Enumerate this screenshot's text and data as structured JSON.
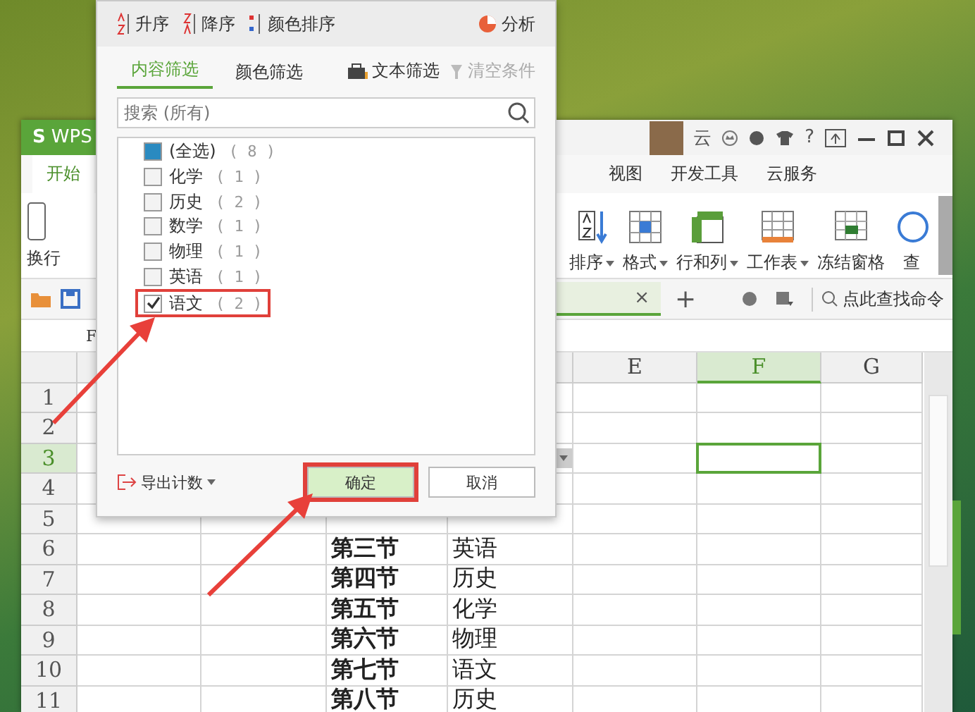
{
  "app": {
    "logo_mark": "S",
    "logo": "WPS",
    "user": "云",
    "help": "?",
    "menu_tabs": [
      {
        "label": "开始",
        "selected": true
      },
      {
        "label": "视图",
        "selected": false
      },
      {
        "label": "开发工具",
        "selected": false
      },
      {
        "label": "云服务",
        "selected": false
      }
    ],
    "left_tool": "换行",
    "tools": [
      {
        "kind": "sort",
        "label": "排序",
        "dropdown": true
      },
      {
        "kind": "format",
        "label": "格式",
        "dropdown": true
      },
      {
        "kind": "rowcol",
        "label": "行和列",
        "dropdown": true
      },
      {
        "kind": "sheet",
        "label": "工作表",
        "dropdown": true
      },
      {
        "kind": "freeze",
        "label": "冻结窗格",
        "dropdown": false
      },
      {
        "kind": "find",
        "label": "查",
        "dropdown": false
      }
    ],
    "doc_close": "×",
    "doc_add": "+",
    "command_search": "点此查找命令",
    "formula_ref": "F",
    "columns": [
      {
        "label": "E",
        "selected": false
      },
      {
        "label": "F",
        "selected": true
      },
      {
        "label": "G",
        "selected": false
      }
    ],
    "rows": [
      {
        "header": "1",
        "selected": false
      },
      {
        "header": "2",
        "selected": false
      },
      {
        "header": "3",
        "selected": true,
        "filter": true
      },
      {
        "header": "4",
        "selected": false
      },
      {
        "header": "5",
        "selected": false
      },
      {
        "header": "6",
        "selected": false,
        "lesson": "第三节",
        "subject": "英语"
      },
      {
        "header": "7",
        "selected": false,
        "lesson": "第四节",
        "subject": "历史"
      },
      {
        "header": "8",
        "selected": false,
        "lesson": "第五节",
        "subject": "化学"
      },
      {
        "header": "9",
        "selected": false,
        "lesson": "第六节",
        "subject": "物理"
      },
      {
        "header": "10",
        "selected": false,
        "lesson": "第七节",
        "subject": "语文"
      },
      {
        "header": "11",
        "selected": false,
        "lesson": "第八节",
        "subject": "历史"
      }
    ]
  },
  "dialog": {
    "sort_bar": [
      {
        "kind": "asc",
        "label": "升序"
      },
      {
        "kind": "desc",
        "label": "降序"
      },
      {
        "kind": "color",
        "label": "颜色排序"
      }
    ],
    "analyze": "分析",
    "tabs": [
      {
        "label": "内容筛选",
        "selected": true
      },
      {
        "label": "颜色筛选",
        "selected": false
      }
    ],
    "text_filter": "文本筛选",
    "clear": {
      "label": "清空条件",
      "disabled": true
    },
    "search": {
      "placeholder": "搜索 (所有)"
    },
    "items": [
      {
        "label": "(全选)",
        "count": "( 8 )",
        "checked": false,
        "partial": true,
        "highlighted": false
      },
      {
        "label": "化学",
        "count": "( 1 )",
        "checked": false,
        "partial": false,
        "highlighted": false
      },
      {
        "label": "历史",
        "count": "( 2 )",
        "checked": false,
        "partial": false,
        "highlighted": false
      },
      {
        "label": "数学",
        "count": "( 1 )",
        "checked": false,
        "partial": false,
        "highlighted": false
      },
      {
        "label": "物理",
        "count": "( 1 )",
        "checked": false,
        "partial": false,
        "highlighted": false
      },
      {
        "label": "英语",
        "count": "( 1 )",
        "checked": false,
        "partial": false,
        "highlighted": false
      },
      {
        "label": "语文",
        "count": "( 2 )",
        "checked": true,
        "partial": false,
        "highlighted": true
      }
    ],
    "export": "导出计数",
    "buttons": [
      {
        "label": "确定",
        "primary": true,
        "highlighted": true
      },
      {
        "label": "取消",
        "primary": false,
        "highlighted": false
      }
    ]
  }
}
